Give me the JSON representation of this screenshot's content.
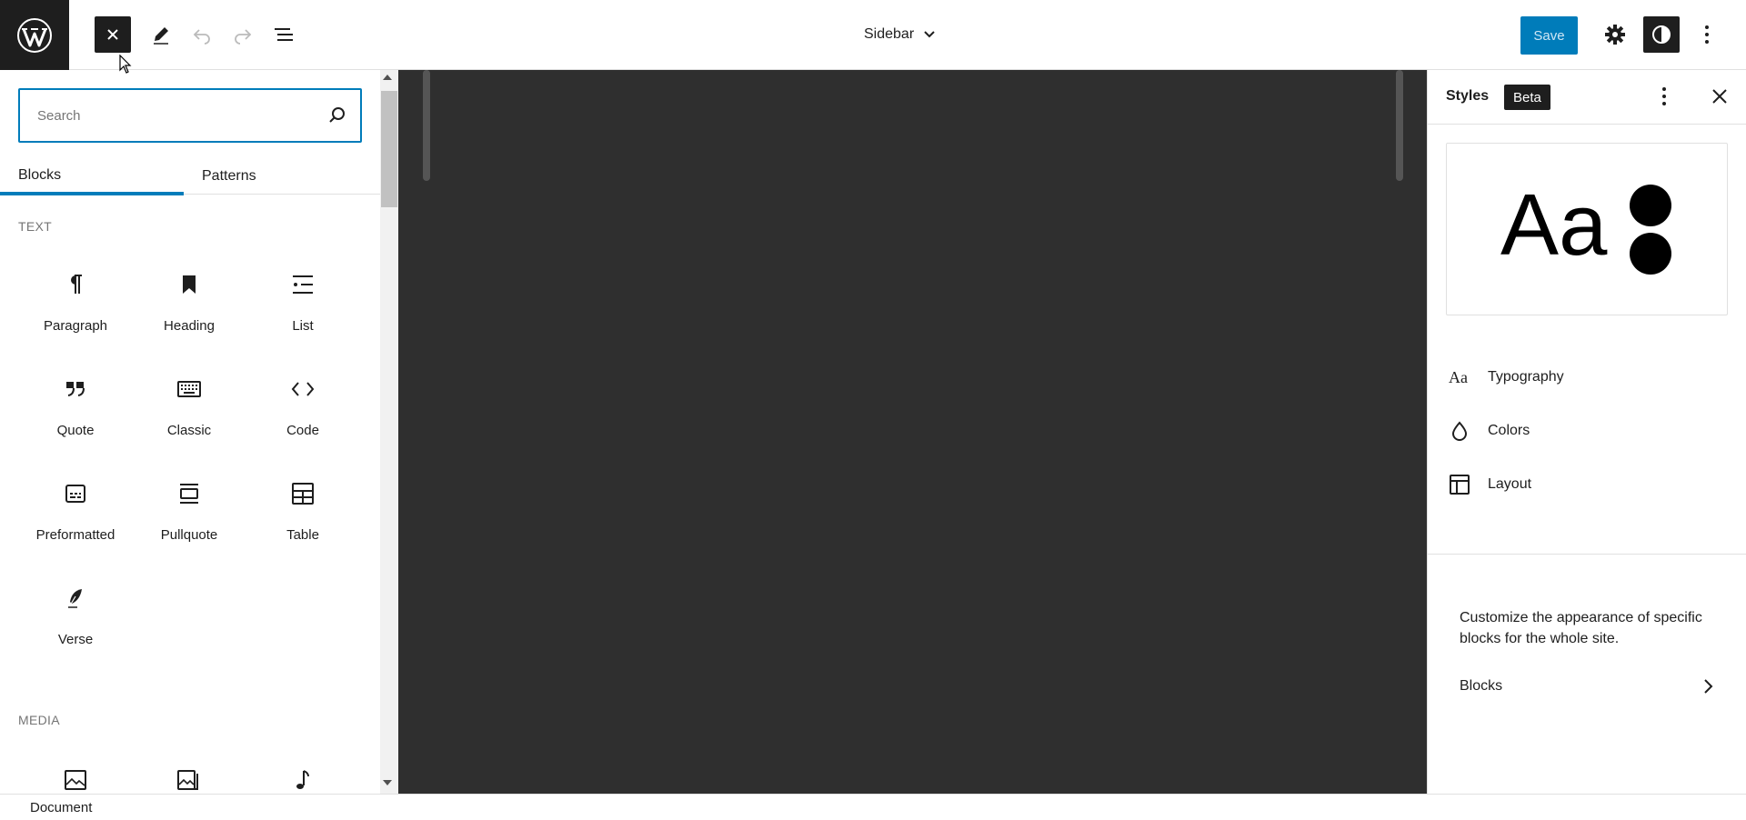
{
  "topbar": {
    "document_title": "Sidebar",
    "save_label": "Save"
  },
  "inserter": {
    "search_placeholder": "Search",
    "tabs": [
      "Blocks",
      "Patterns"
    ],
    "text_category": "TEXT",
    "text_blocks": [
      {
        "label": "Paragraph",
        "icon": "paragraph-icon"
      },
      {
        "label": "Heading",
        "icon": "heading-icon"
      },
      {
        "label": "List",
        "icon": "list-icon"
      },
      {
        "label": "Quote",
        "icon": "quote-icon"
      },
      {
        "label": "Classic",
        "icon": "keyboard-icon"
      },
      {
        "label": "Code",
        "icon": "code-icon"
      },
      {
        "label": "Preformatted",
        "icon": "preformatted-icon"
      },
      {
        "label": "Pullquote",
        "icon": "pullquote-icon"
      },
      {
        "label": "Table",
        "icon": "table-icon"
      },
      {
        "label": "Verse",
        "icon": "verse-icon"
      }
    ],
    "media_category": "MEDIA"
  },
  "sidebar": {
    "title": "Styles",
    "badge": "Beta",
    "preview_text": "Aa",
    "nav": [
      {
        "label": "Typography",
        "icon": "typography-icon"
      },
      {
        "label": "Colors",
        "icon": "droplet-icon"
      },
      {
        "label": "Layout",
        "icon": "layout-icon"
      }
    ],
    "description": "Customize the appearance of specific blocks for the whole site.",
    "blocks_link": "Blocks"
  },
  "footer": {
    "breadcrumb": "Document"
  },
  "colors": {
    "accent": "#007cba",
    "canvas": "#2f2f2f",
    "dark": "#1e1e1e"
  }
}
